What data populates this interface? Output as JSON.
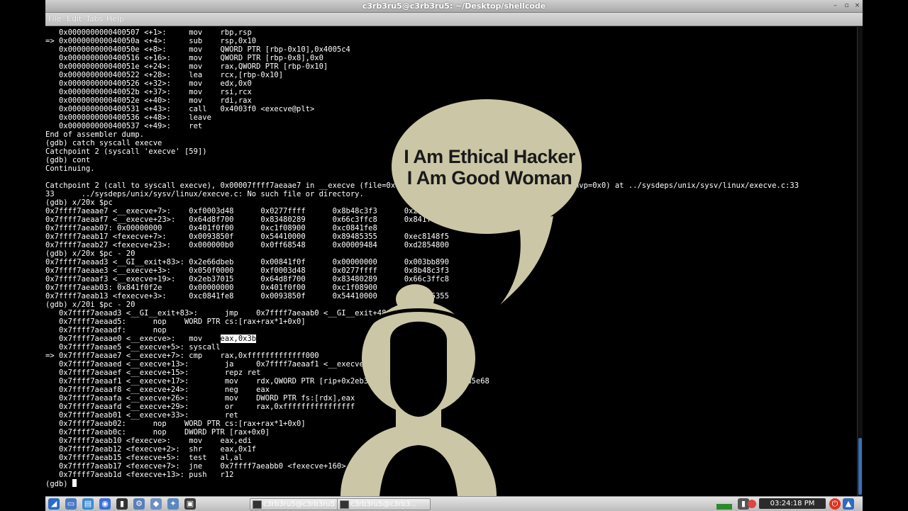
{
  "window": {
    "title": "c3rb3ru5@c3rb3ru5: ~/Desktop/shellcode",
    "buttons": [
      "–",
      "▫",
      "×"
    ]
  },
  "menu": [
    "File",
    "Edit",
    "Tabs",
    "Help"
  ],
  "overlay": {
    "lines": [
      "I Am Ethical Hacker",
      "I Am Good Woman"
    ],
    "bubble_color": "#cbc7a6"
  },
  "terminal": {
    "lines": [
      "   0x0000000000400507 <+1>:     mov    rbp,rsp",
      "=> 0x000000000040050a <+4>:     sub    rsp,0x10",
      "   0x000000000040050e <+8>:     mov    QWORD PTR [rbp-0x10],0x4005c4",
      "   0x0000000000400516 <+16>:    mov    QWORD PTR [rbp-0x8],0x0",
      "   0x000000000040051e <+24>:    mov    rax,QWORD PTR [rbp-0x10]",
      "   0x0000000000400522 <+28>:    lea    rcx,[rbp-0x10]",
      "   0x0000000000400526 <+32>:    mov    edx,0x0",
      "   0x000000000040052b <+37>:    mov    rsi,rcx",
      "   0x000000000040052e <+40>:    mov    rdi,rax",
      "   0x0000000000400531 <+43>:    call   0x4003f0 <execve@plt>",
      "   0x0000000000400536 <+48>:    leave",
      "   0x0000000000400537 <+49>:    ret",
      "End of assembler dump.",
      "(gdb) catch syscall execve",
      "Catchpoint 2 (syscall 'execve' [59])",
      "(gdb) cont",
      "Continuing.",
      "",
      "Catchpoint 2 (call to syscall execve), 0x00007ffff7aeaae7 in __execve (file=0x4005c4 \"/bin/sh\", argv=0x7fffffffe2d0, envp=0x0) at ../sysdeps/unix/sysv/linux/execve.c:33",
      "33      ../sysdeps/unix/sysv/linux/execve.c: No such file or directory.",
      "(gdb) x/20x $pc",
      "0x7ffff7aeaae7 <__execve+7>:    0xf0003d48      0x0277ffff      0x8b48c3f3      0x2eb37015",
      "0x7ffff7aeaaf7 <__execve+23>:   0x64d8f700      0x83480289      0x66c3ffc8      0x841f0f2e",
      "0x7ffff7aeab07: 0x00000000      0x401f0f00      0xc1f08900      0xc0841fe8",
      "0x7ffff7aeab17 <fexecve+7>:     0x0093850f      0x54410000      0x89485355      0xec8148f5",
      "0x7ffff7aeab27 <fexecve+23>:    0x000000b0      0x0ff68548      0x00009484      0xd2854800",
      "(gdb) x/20x $pc - 20",
      "0x7ffff7aeaad3 <__GI__exit+83>: 0x2e66dbeb      0x00841f0f      0x00000000      0x003bb890",
      "0x7ffff7aeaae3 <__execve+3>:    0x050f0000      0xf0003d48      0x0277ffff      0x8b48c3f3",
      "0x7ffff7aeaaf3 <__execve+19>:   0x2eb37015      0x64d8f700      0x83480289      0x66c3ffc8",
      "0x7ffff7aeab03: 0x841f0f2e      0x00000000      0x401f0f00      0xc1f08900",
      "0x7ffff7aeab13 <fexecve+3>:     0xc0841fe8      0x0093850f      0x54410000      0x89485355",
      "(gdb) x/20i $pc - 20",
      "   0x7ffff7aeaad3 <__GI__exit+83>:      jmp    0x7ffff7aeaab0 <__GI__exit+48>",
      "   0x7ffff7aeaad5:      nop    WORD PTR cs:[rax+rax*1+0x0]",
      "   0x7ffff7aeaadf:      nop",
      "   0x7ffff7aeaae0 <__execve>:   mov    eax,0x3b",
      "   0x7ffff7aeaae5 <__execve+5>: syscall",
      "=> 0x7ffff7aeaae7 <__execve+7>: cmp    rax,0xfffffffffffff000",
      "   0x7ffff7aeaaed <__execve+13>:        ja     0x7ffff7aeaaf1 <__execve+17>",
      "   0x7ffff7aeaaef <__execve+15>:        repz ret",
      "   0x7ffff7aeaaf1 <__execve+17>:        mov    rdx,QWORD PTR [rip+0x2eb370]        # 0x7ffff7dd5e68",
      "   0x7ffff7aeaaf8 <__execve+24>:        neg    eax",
      "   0x7ffff7aeaafa <__execve+26>:        mov    DWORD PTR fs:[rdx],eax",
      "   0x7ffff7aeaafd <__execve+29>:        or     rax,0xffffffffffffffff",
      "   0x7ffff7aeab01 <__execve+33>:        ret",
      "   0x7ffff7aeab02:      nop    WORD PTR cs:[rax+rax*1+0x0]",
      "   0x7ffff7aeab0c:      nop    DWORD PTR [rax+0x0]",
      "   0x7ffff7aeab10 <fexecve>:    mov    eax,edi",
      "   0x7ffff7aeab12 <fexecve+2>:  shr    eax,0x1f",
      "   0x7ffff7aeab15 <fexecve+5>:  test   al,al",
      "   0x7ffff7aeab17 <fexecve+7>:  jne    0x7ffff7aeabb0 <fexecve+160>",
      "   0x7ffff7aeab1d <fexecve+13>: push   r12"
    ],
    "highlight": {
      "pre": "   0x7ffff7aeaae0 <__execve>:   mov    ",
      "sel": "eax,0x3b"
    },
    "prompt": "(gdb) "
  },
  "taskbar": {
    "launchers": [
      {
        "name": "menu-icon",
        "glyph": "◢",
        "color": "#2a6ac8"
      },
      {
        "name": "show-desktop-icon",
        "glyph": "▭",
        "color": "#4a79c4"
      },
      {
        "name": "file-manager-icon",
        "glyph": "▤",
        "color": "#3d8ad0"
      },
      {
        "name": "browser-icon",
        "glyph": "◉",
        "color": "#3a6fd8"
      },
      {
        "name": "terminal-icon",
        "glyph": "▮",
        "color": "#333333"
      },
      {
        "name": "settings-icon",
        "glyph": "⚙",
        "color": "#5a7fb8"
      },
      {
        "name": "cube-icon",
        "glyph": "◆",
        "color": "#6f8fc6"
      },
      {
        "name": "network-icon",
        "glyph": "✦",
        "color": "#5b87c0"
      },
      {
        "name": "monitor-icon",
        "glyph": "▣",
        "color": "#3c3c3c"
      }
    ],
    "tasks": [
      "c3rb3ru5@c3rb3ru5",
      "c3rb3ru5@c3rb3..."
    ],
    "clock": "03:24:18 PM"
  }
}
